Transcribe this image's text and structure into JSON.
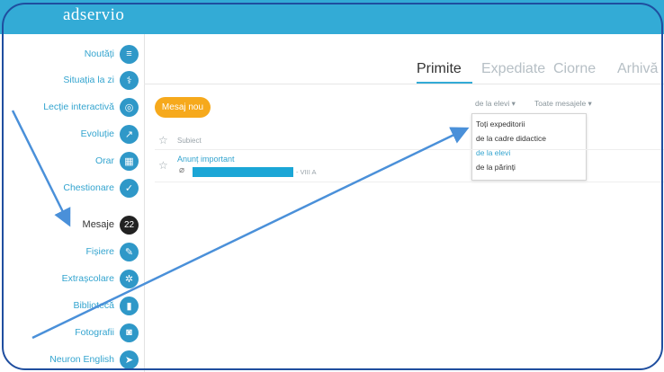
{
  "app": {
    "logo": "adservio"
  },
  "sidebar": {
    "items": [
      {
        "label": "Noutăți",
        "icon": "news-icon"
      },
      {
        "label": "Situația la zi",
        "icon": "stethoscope-icon"
      },
      {
        "label": "Lecție interactivă",
        "icon": "lesson-icon"
      },
      {
        "label": "Evoluție",
        "icon": "chart-line-icon"
      },
      {
        "label": "Orar",
        "icon": "calendar-icon"
      },
      {
        "label": "Chestionare",
        "icon": "check-icon"
      },
      {
        "label": "Mesaje",
        "badge": "22",
        "active": true
      },
      {
        "label": "Fișiere",
        "icon": "paperclip-icon"
      },
      {
        "label": "Extrașcolare",
        "icon": "extracurricular-icon"
      },
      {
        "label": "Bibliotecă",
        "icon": "book-icon"
      },
      {
        "label": "Fotografii",
        "icon": "photo-icon"
      },
      {
        "label": "Neuron English",
        "icon": "paper-plane-icon"
      }
    ]
  },
  "tabs": [
    {
      "label": "Primite",
      "active": true
    },
    {
      "label": "Expediate"
    },
    {
      "label": "Ciorne"
    },
    {
      "label": "Arhivă"
    }
  ],
  "toolbar": {
    "new_message": "Mesaj nou",
    "filter_from": "de la elevi ▾",
    "filter_status": "Toate mesajele ▾"
  },
  "dropdown": {
    "options": [
      "Toți expeditorii",
      "de la cadre didactice",
      "de la elevi",
      "de la părinți"
    ],
    "selected": "de la elevi"
  },
  "table": {
    "header": "Subiect",
    "rows": [
      {
        "subject": "Anunț important",
        "class": "- VIII A"
      }
    ]
  },
  "colors": {
    "brand": "#33abd6",
    "button": "#f6a91c",
    "annotation": "#4a90d9"
  }
}
